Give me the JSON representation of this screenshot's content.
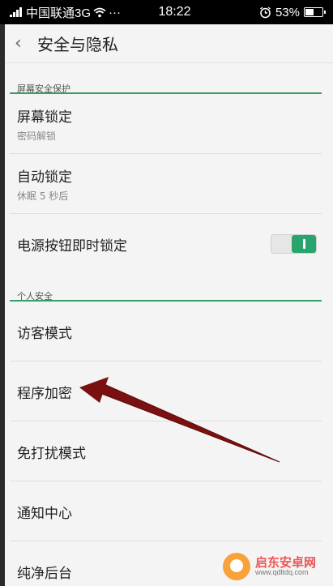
{
  "status_bar": {
    "carrier": "中国联通3G",
    "more": "···",
    "time": "18:22",
    "battery_percent": "53%",
    "battery_level": 0.53,
    "icons": [
      "signal-icon",
      "wifi-icon",
      "alarm-icon",
      "battery-icon"
    ]
  },
  "header": {
    "back_icon": "chevron-left-icon",
    "title": "安全与隐私"
  },
  "sections": [
    {
      "label": "屏幕安全保护",
      "items": [
        {
          "title": "屏幕锁定",
          "subtitle": "密码解锁"
        },
        {
          "title": "自动锁定",
          "subtitle": "休眠 5 秒后"
        },
        {
          "title": "电源按钮即时锁定",
          "toggle": true
        }
      ]
    },
    {
      "label": "个人安全",
      "items": [
        {
          "title": "访客模式"
        },
        {
          "title": "程序加密"
        },
        {
          "title": "免打扰模式"
        },
        {
          "title": "通知中心"
        },
        {
          "title": "纯净后台"
        }
      ]
    }
  ],
  "watermark": {
    "name": "启东安卓网",
    "url": "www.qdltdq.com"
  },
  "colors": {
    "accent": "#2aa46c",
    "arrow": "#7a1010"
  }
}
